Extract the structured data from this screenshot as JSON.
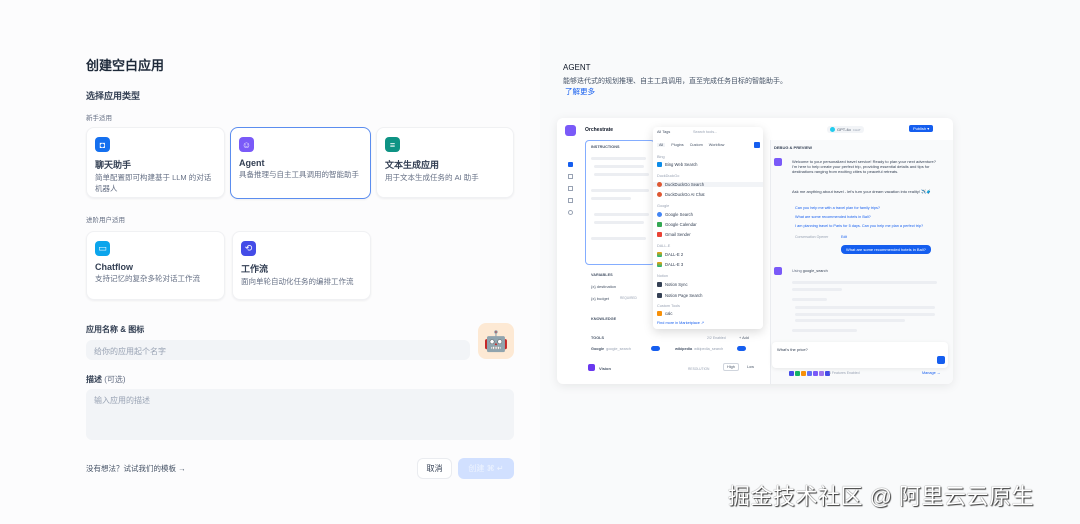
{
  "title": "创建空白应用",
  "app_type_label": "选择应用类型",
  "beginner_label": "新手适用",
  "advanced_label": "进阶用户适用",
  "cards": [
    {
      "name": "聊天助手",
      "desc": "简单配置即可构建基于 LLM 的对话机器人",
      "color": "#1570ef",
      "icon": "chat-bot-icon"
    },
    {
      "name": "Agent",
      "desc": "具备推理与自主工具调用的智能助手",
      "color": "#7a5af8",
      "icon": "agent-icon"
    },
    {
      "name": "文本生成应用",
      "desc": "用于文本生成任务的 AI 助手",
      "color": "#0e9384",
      "icon": "text-generation-icon"
    },
    {
      "name": "Chatflow",
      "desc": "支持记忆的复杂多轮对话工作流",
      "color": "#0ba5ec",
      "icon": "chatflow-icon"
    },
    {
      "name": "工作流",
      "desc": "面向单轮自动化任务的编排工作流",
      "color": "#444ce7",
      "icon": "workflow-icon"
    }
  ],
  "name_label": "应用名称 & 图标",
  "name_placeholder": "给你的应用起个名字",
  "app_icon": "🤖",
  "desc_label": "描述",
  "desc_optional": "(可选)",
  "desc_placeholder": "输入应用的描述",
  "template_link": "没有想法？试试我们的模板 →",
  "cancel": "取消",
  "create": "创建 ⌘ ↵",
  "preview": {
    "heading": "AGENT",
    "desc": "能够迭代式的规划推理、自主工具调用，直至完成任务目标的智能助手。",
    "learn_more": "了解更多",
    "orchestrate": "Orchestrate",
    "instructions": "INSTRUCTIONS",
    "variables": "VARIABLES",
    "var1": "{x} destination",
    "var2": "{x} budget",
    "var2_badge": "REQUIRED",
    "knowledge": "KNOWLEDGE",
    "tools": "TOOLS",
    "tools_enabled": "2/2 Enabled",
    "add": "+ Add",
    "tool1": "Google",
    "tool1_id": "google_search",
    "tool2": "wikipedia",
    "tool2_id": "wikipedia_search",
    "vision": "Vision",
    "resolution": "RESOLUTION",
    "high": "High",
    "low": "Low",
    "dropdown": {
      "tags": "All Tags",
      "search": "Search tools...",
      "tabs": [
        "All",
        "Plugins",
        "Custom",
        "Workflow"
      ],
      "groups": [
        {
          "cat": "Bing",
          "items": [
            "Bing Web Search"
          ]
        },
        {
          "cat": "DuckDuckGo",
          "items": [
            "DuckDuckGo Search",
            "DuckDuckGo AI Chat"
          ]
        },
        {
          "cat": "Google",
          "items": [
            "Google Search",
            "Google Calendar",
            "Gmail Sender"
          ]
        },
        {
          "cat": "DALL-E",
          "items": [
            "DALL-E 2",
            "DALL-E 3"
          ]
        },
        {
          "cat": "Notion",
          "items": [
            "Notion Sync",
            "Notion Page Search"
          ]
        },
        {
          "cat": "Custom Tools",
          "items": [
            "calc"
          ]
        }
      ],
      "marketplace": "Find more in Marketplace ↗"
    },
    "model": "GPT-4o",
    "model_badge": "CHAT",
    "publish": "Publish ▾",
    "debug": "DEBUG & PREVIEW",
    "welcome": "Welcome to your personalized travel service! Ready to plan your next adventure? I'm here to help create your perfect trip, providing essential details and tips for destinations ranging from exciting cities to peaceful retreats.",
    "welcome2": "Ask me anything about travel - let's turn your dream vacation into reality! ✈️🧳",
    "suggestions": [
      "Can you help me with a travel plan for family trips?",
      "What are some recommended hotels in Bali?",
      "I am planning travel to Paris for 5 days. Can you help me plan a perfect trip?"
    ],
    "opener": "Conversation Opener",
    "edit": "Edit",
    "user_msg": "What are some recommended hotels in Bali?",
    "using": "Using",
    "using_tool": "google_search",
    "input": "What's the price?",
    "features": "6 Features Enabled",
    "manage": "Manage →"
  },
  "watermark": "掘金技术社区 @ 阿里云云原生"
}
